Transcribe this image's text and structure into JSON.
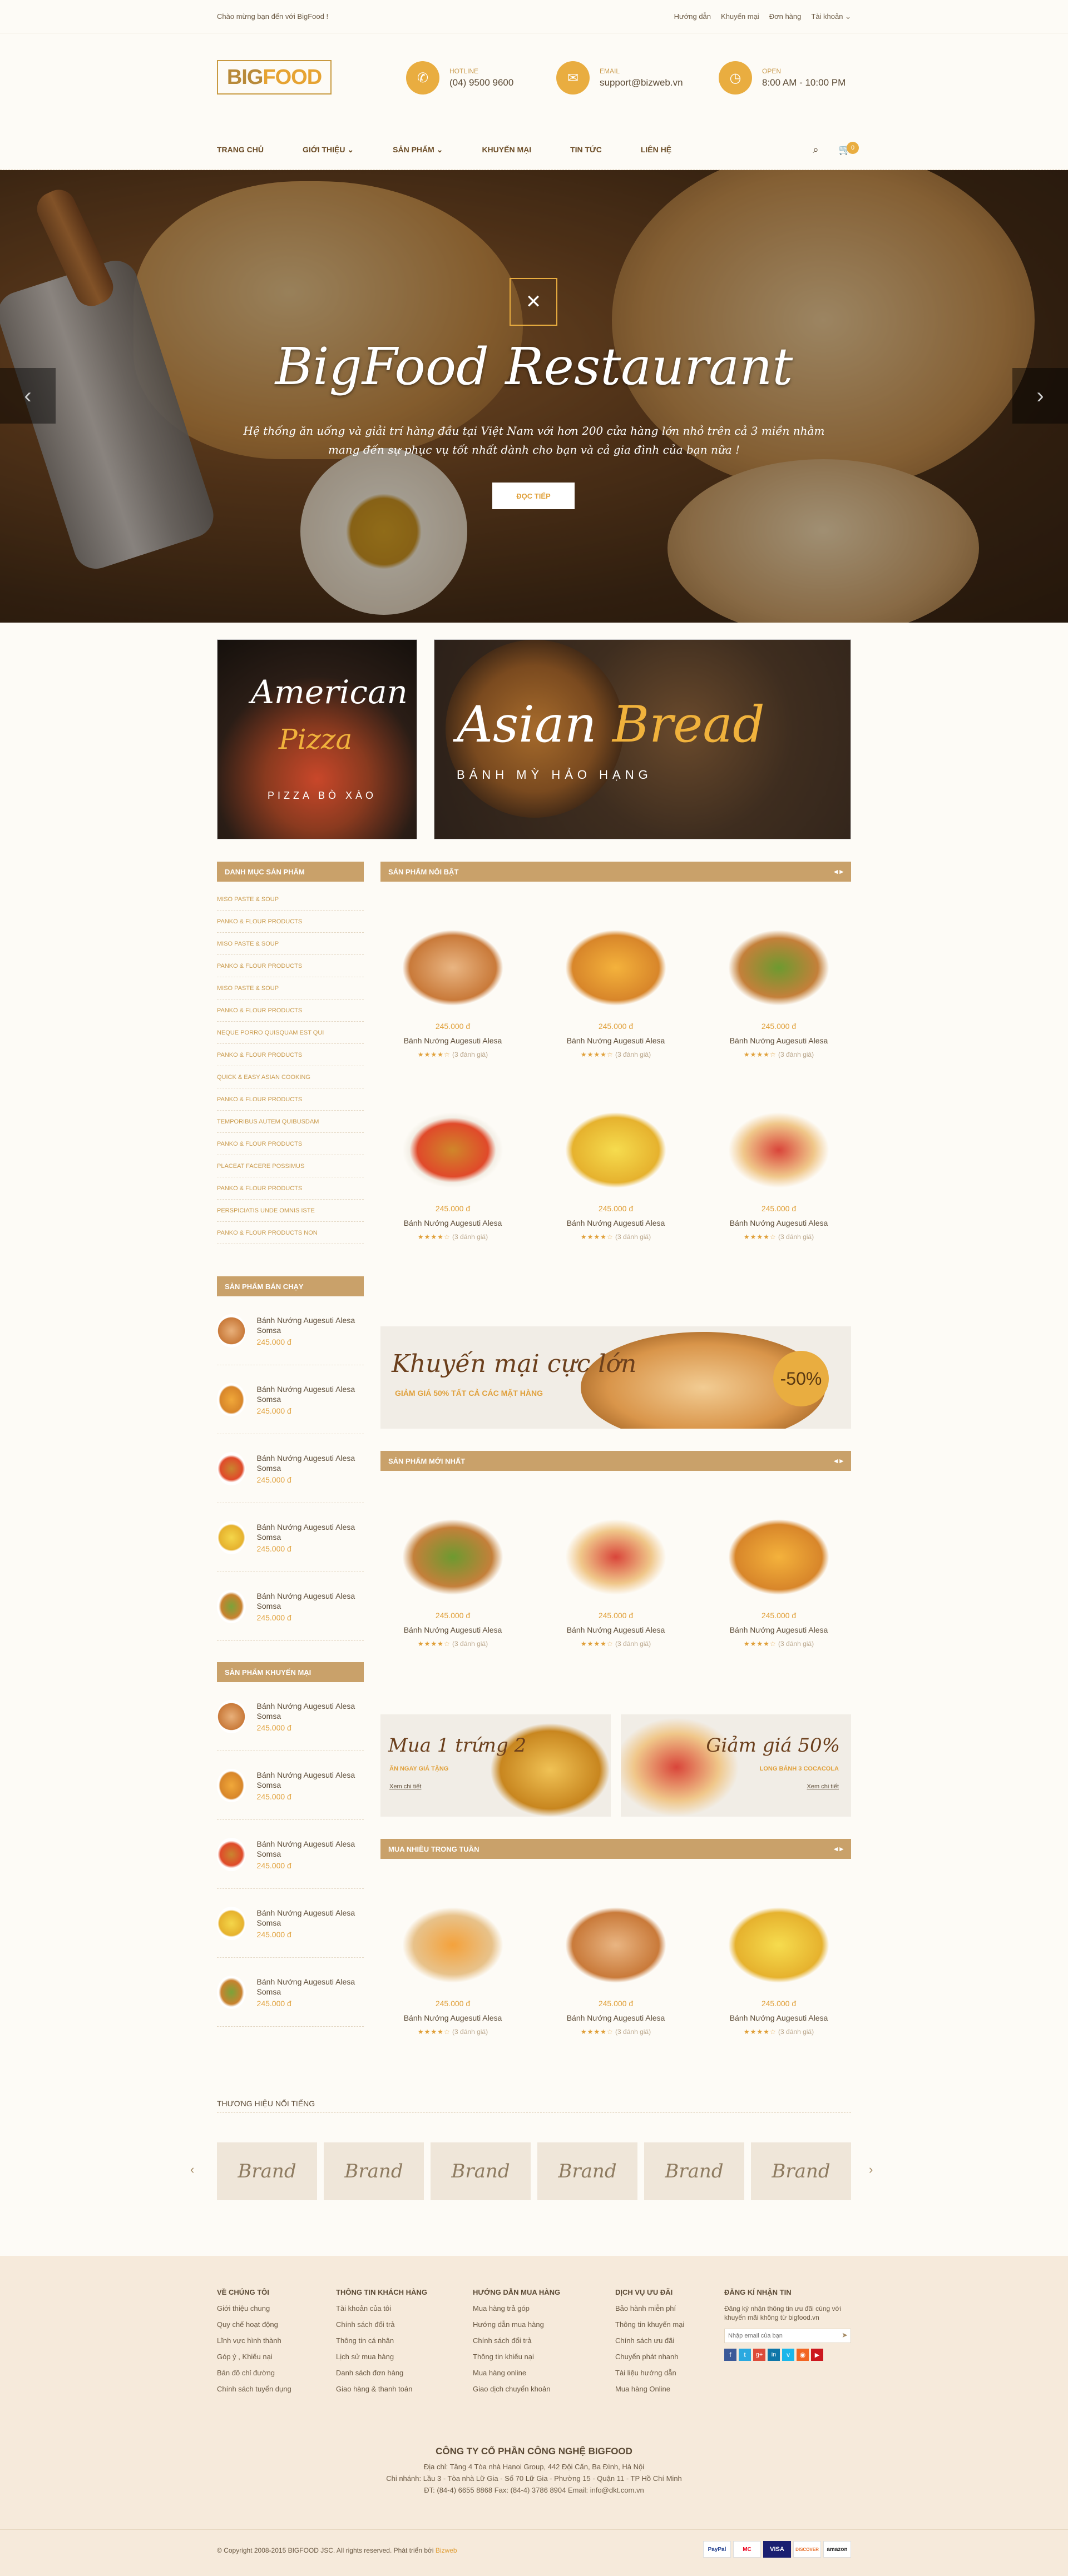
{
  "topbar": {
    "welcome": "Chào mừng bạn đến với BigFood !",
    "links": [
      "Hướng dẫn",
      "Khuyến mại",
      "Đơn hàng",
      "Tài khoản"
    ]
  },
  "header": {
    "logo_big": "BIG",
    "logo_food": "FOOD",
    "hotline_label": "HOTLINE",
    "hotline_value": "(04) 9500 9600",
    "email_label": "EMAIL",
    "email_value": "support@bizweb.vn",
    "open_label": "OPEN",
    "open_value": "8:00 AM - 10:00 PM"
  },
  "nav": {
    "items": [
      "TRANG CHỦ",
      "GIỚI THIỆU",
      "SẢN PHẨM",
      "KHUYẾN MẠI",
      "TIN TỨC",
      "LIÊN HỆ"
    ],
    "cart_count": "0"
  },
  "hero": {
    "title": "BigFood Restaurant",
    "subtitle_1": "Hệ thống ăn uống và giải trí hàng đầu tại Việt Nam với hơn 200 cửa hàng lớn nhỏ trên cả 3 miền nhằm",
    "subtitle_2": "mang đến sự phục vụ tốt nhất dành cho bạn và cả gia đình của bạn nữa !",
    "button": "ĐỌC TIẾP"
  },
  "banners": {
    "pizza_title_1": "American",
    "pizza_title_2": "Pizza",
    "pizza_caption": "PIZZA BÒ XÀO",
    "bread_title_1": "Asian",
    "bread_title_2": "Bread",
    "bread_caption": "BÁNH MỲ HẢO HẠNG"
  },
  "sidebar": {
    "category_title": "DANH MỤC SẢN PHẨM",
    "categories": [
      "MISO PASTE & SOUP",
      "PANKO & FLOUR PRODUCTS",
      "MISO PASTE & SOUP",
      "PANKO & FLOUR PRODUCTS",
      "MISO PASTE & SOUP",
      "PANKO & FLOUR PRODUCTS",
      "NEQUE PORRO QUISQUAM EST QUI",
      "PANKO & FLOUR PRODUCTS",
      "QUICK & EASY ASIAN COOKING",
      "PANKO & FLOUR PRODUCTS",
      "TEMPORIBUS AUTEM QUIBUSDAM",
      "PANKO & FLOUR PRODUCTS",
      "PLACEAT FACERE POSSIMUS",
      "PANKO & FLOUR PRODUCTS",
      "PERSPICIATIS UNDE OMNIS ISTE",
      "PANKO & FLOUR PRODUCTS NON"
    ],
    "bestseller_title": "SẢN PHẨM BÁN CHẠY",
    "promo_title": "SẢN PHẨM KHUYẾN MẠI",
    "product_name": "Bánh Nướng Augesuti Alesa Somsa",
    "product_price": "245.000 đ"
  },
  "sections": {
    "featured": "SẢN PHẨM NỔI BẬT",
    "newest": "SẢN PHẨM MỚI NHẤT",
    "best_week": "MUA NHIỀU TRONG TUẦN",
    "brands": "THƯƠNG HIỆU NỔI TIẾNG"
  },
  "product": {
    "name": "Bánh Nướng Augesuti Alesa",
    "price": "245.000 đ",
    "stars": "★★★★☆",
    "reviews": "(3 đánh giá)"
  },
  "promo_big": {
    "title": "Khuyến mại cực lớn",
    "subtitle": "GIẢM GIÁ 50% TẤT CẢ CÁC MẶT HÀNG",
    "badge": "-50%"
  },
  "promo_small": {
    "left_title": "Mua 1 trứng 2",
    "left_sub": "ĂN NGAY GIÁ TẶNG",
    "left_link": "Xem chi tiết",
    "right_title": "Giảm giá 50%",
    "right_sub": "LONG BÁNH 3 COCACOLA",
    "right_link": "Xem chi tiết"
  },
  "brands": {
    "label": "Brand"
  },
  "footer": {
    "col1_title": "VỀ CHÚNG TÔI",
    "col1": [
      "Giới thiệu chung",
      "Quy chế hoạt động",
      "Lĩnh vực hình thành",
      "Góp ý , Khiếu nại",
      "Bản đồ chỉ đường",
      "Chính sách tuyển dụng"
    ],
    "col2_title": "THÔNG TIN KHÁCH HÀNG",
    "col2": [
      "Tài khoản của tôi",
      "Chính sách đổi trả",
      "Thông tin cá nhân",
      "Lịch sử mua hàng",
      "Danh sách đơn hàng",
      "Giao hàng & thanh toán"
    ],
    "col3_title": "HƯỚNG DẪN MUA HÀNG",
    "col3": [
      "Mua hàng trả góp",
      "Hướng dẫn mua hàng",
      "Chính sách đổi trả",
      "Thông tin khiếu nại",
      "Mua hàng online",
      "Giao dịch chuyển khoản"
    ],
    "col4_title": "DỊCH VỤ ƯU ĐÃI",
    "col4": [
      "Bảo hành miễn phí",
      "Thông tin khuyến mại",
      "Chính sách ưu đãi",
      "Chuyển phát nhanh",
      "Tài liệu hướng dẫn",
      "Mua hàng Online"
    ],
    "col5_title": "ĐĂNG KÍ NHẬN TIN",
    "col5_text_1": "Đăng ký nhận thông tin ưu đãi cùng với",
    "col5_text_2": "khuyến mãi không từ bigfood.vn",
    "email_placeholder": "Nhập email của bạn",
    "company_name": "CÔNG TY CỔ PHẦN CÔNG NGHỆ BIGFOOD",
    "address_1": "Địa chỉ: Tầng 4 Tòa nhà Hanoi Group, 442 Đội Cấn, Ba Đình, Hà Nội",
    "address_2": "Chi nhánh: Lầu 3 - Tòa nhà Lữ Gia - Số 70 Lữ Gia - Phường 15 - Quận 11 - TP Hồ Chí Minh",
    "address_3": "ĐT: (84-4) 6655 8868     Fax: (84-4) 3786 8904     Email: info@dkt.com.vn",
    "copyright": "© Copyright 2008-2015 BIGFOOD JSC. All rights reserved. Phát triển bởi",
    "developer": "Bizweb",
    "payments": [
      "PayPal",
      "MC",
      "VISA",
      "DISCOVER",
      "amazon"
    ]
  },
  "colors": {
    "accent": "#e9ad40",
    "section_bar": "#c9a16a",
    "price": "#e0a03a",
    "background": "#fdfbf6"
  }
}
